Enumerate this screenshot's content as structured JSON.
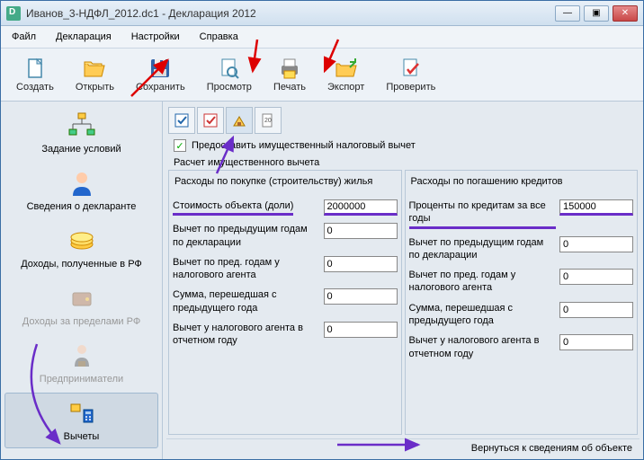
{
  "title": "Иванов_3-НДФЛ_2012.dc1 - Декларация 2012",
  "menu": [
    "Файл",
    "Декларация",
    "Настройки",
    "Справка"
  ],
  "toolbar": [
    {
      "label": "Создать",
      "icon": "file-new"
    },
    {
      "label": "Открыть",
      "icon": "folder-open"
    },
    {
      "label": "Сохранить",
      "icon": "disk"
    },
    {
      "label": "Просмотр",
      "icon": "preview"
    },
    {
      "label": "Печать",
      "icon": "printer"
    },
    {
      "label": "Экспорт",
      "icon": "export"
    },
    {
      "label": "Проверить",
      "icon": "check"
    }
  ],
  "sidebar": [
    {
      "label": "Задание условий",
      "icon": "tree"
    },
    {
      "label": "Сведения о декларанте",
      "icon": "person"
    },
    {
      "label": "Доходы, полученные в РФ",
      "icon": "money"
    },
    {
      "label": "Доходы за пределами РФ",
      "icon": "wallet",
      "disabled": true
    },
    {
      "label": "Предприниматели",
      "icon": "bizman",
      "disabled": true
    },
    {
      "label": "Вычеты",
      "icon": "calc",
      "selected": true
    }
  ],
  "checkbox_label": "Предоставить имущественный налоговый вычет",
  "checkbox_checked": true,
  "section": "Расчет имущественного вычета",
  "left_col": {
    "title": "Расходы по покупке (строительству) жилья",
    "fields": [
      {
        "label": "Стоимость объекта (доли)",
        "value": "2000000",
        "highlight": true
      },
      {
        "label": "Вычет по предыдущим годам по декларации",
        "value": "0"
      },
      {
        "label": "Вычет по пред. годам у налогового агента",
        "value": "0"
      },
      {
        "label": "Сумма, перешедшая с предыдущего года",
        "value": "0"
      },
      {
        "label": "Вычет у налогового агента в отчетном году",
        "value": "0"
      }
    ]
  },
  "right_col": {
    "title": "Расходы по погашению кредитов",
    "fields": [
      {
        "label": "Проценты по кредитам за все годы",
        "value": "150000",
        "highlight": true
      },
      {
        "label": "Вычет по предыдущим годам по декларации",
        "value": "0"
      },
      {
        "label": "Вычет по пред. годам у налогового агента",
        "value": "0"
      },
      {
        "label": "Сумма, перешедшая с предыдущего года",
        "value": "0"
      },
      {
        "label": "Вычет у налогового агента в отчетном году",
        "value": "0"
      }
    ]
  },
  "bottom_link": "Вернуться к сведениям об объекте"
}
